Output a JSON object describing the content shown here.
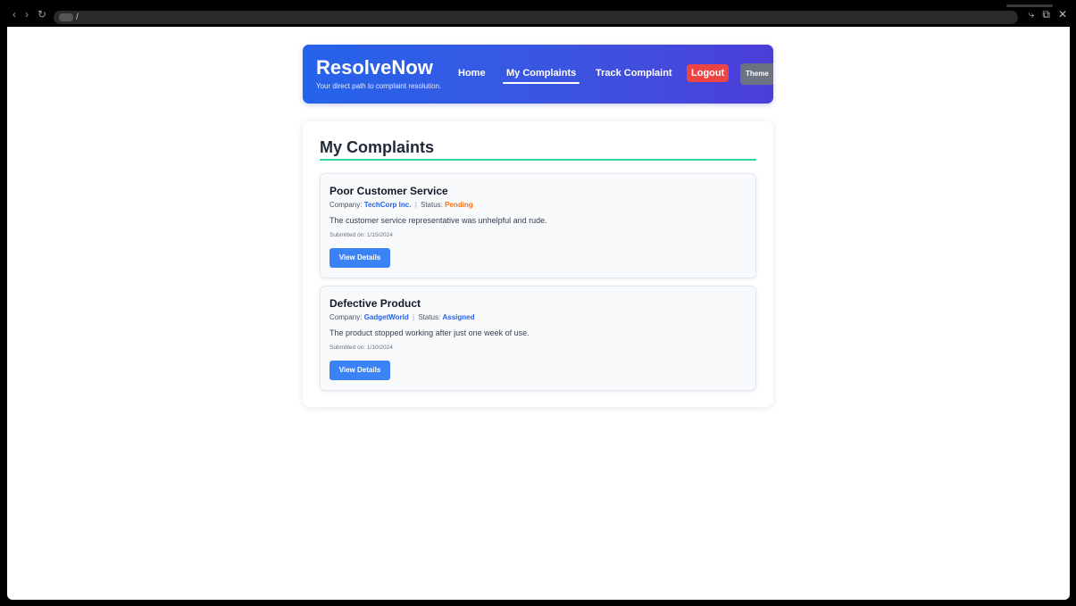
{
  "browser": {
    "url": "/"
  },
  "header": {
    "brand": "ResolveNow",
    "tagline": "Your direct path to complaint resolution.",
    "nav": {
      "home": "Home",
      "my_complaints": "My Complaints",
      "track_complaint": "Track Complaint",
      "logout": "Logout",
      "theme": "Theme"
    }
  },
  "main": {
    "title": "My Complaints",
    "complaints": [
      {
        "title": "Poor Customer Service",
        "company_label": "Company:",
        "company": "TechCorp Inc.",
        "status_label": "Status:",
        "status": "Pending",
        "description": "The customer service representative was unhelpful and rude.",
        "submitted": "Submitted on: 1/15/2024",
        "button": "View Details"
      },
      {
        "title": "Defective Product",
        "company_label": "Company:",
        "company": "GadgetWorld",
        "status_label": "Status:",
        "status": "Assigned",
        "description": "The product stopped working after just one week of use.",
        "submitted": "Submitted on: 1/10/2024",
        "button": "View Details"
      }
    ]
  },
  "colors": {
    "header_gradient_start": "#2563eb",
    "header_gradient_end": "#4c3ed8",
    "logout": "#ef4444",
    "theme_button": "#6b7280",
    "title_rule": "#34d399",
    "status_pending": "#f97316",
    "status_assigned": "#2563eb",
    "primary_button": "#3b82f6"
  }
}
